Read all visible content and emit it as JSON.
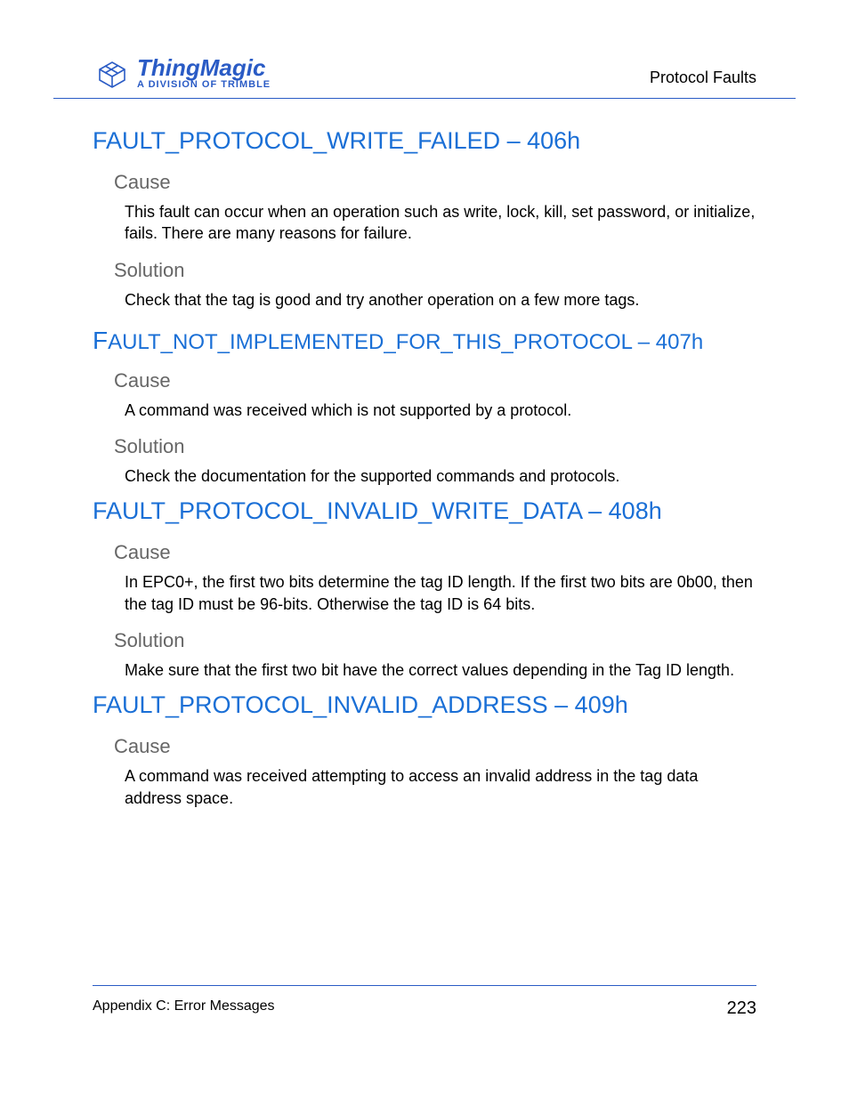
{
  "header": {
    "brand": "ThingMagic",
    "tagline": "A DIVISION OF TRIMBLE",
    "section": "Protocol Faults"
  },
  "faults": [
    {
      "title": "FAULT_PROTOCOL_WRITE_FAILED – 406h",
      "style": "h1",
      "parts": [
        {
          "label": "Cause",
          "text": "This fault can occur when an operation such as write, lock, kill, set password, or initialize, fails. There are many reasons for failure."
        },
        {
          "label": "Solution",
          "text": "Check that the tag is good and try another operation on a few more tags."
        }
      ]
    },
    {
      "title_caps": "F",
      "title_rest": "AULT_NOT_IMPLEMENTED_FOR_THIS_PROTOCOL – 407h",
      "style": "h1b",
      "parts": [
        {
          "label": "Cause",
          "text": "A command was received which is not supported by a protocol."
        },
        {
          "label": "Solution",
          "text": "Check the documentation for the supported commands and protocols."
        }
      ]
    },
    {
      "title": "FAULT_PROTOCOL_INVALID_WRITE_DATA – 408h",
      "style": "h1",
      "parts": [
        {
          "label": "Cause",
          "text": "In EPC0+, the first two bits determine the tag ID length. If the first two bits are 0b00, then the tag ID must be 96-bits. Otherwise the tag ID is 64 bits."
        },
        {
          "label": "Solution",
          "text": "Make sure that the first two bit have the correct values depending in the Tag ID length."
        }
      ]
    },
    {
      "title": "FAULT_PROTOCOL_INVALID_ADDRESS – 409h",
      "style": "h1",
      "parts": [
        {
          "label": "Cause",
          "text": "A command was received attempting to access an invalid address in the tag data address space."
        }
      ]
    }
  ],
  "footer": {
    "left": "Appendix C: Error Messages",
    "page": "223"
  }
}
